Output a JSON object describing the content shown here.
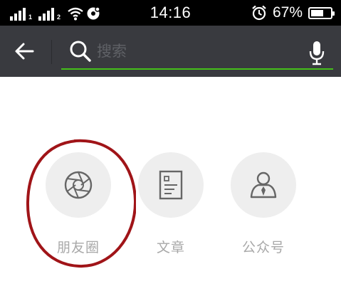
{
  "status_bar": {
    "time": "14:16",
    "battery_percent": "67%",
    "battery_level": 0.67,
    "sim1_label": "1",
    "sim2_label": "2",
    "icons": [
      "signal-icon",
      "signal-icon",
      "wifi-icon",
      "notification-icon",
      "alarm-icon",
      "battery-icon"
    ]
  },
  "search": {
    "placeholder": "搜索",
    "value": "",
    "underline_color": "#45c01a",
    "icons": [
      "back-arrow-icon",
      "search-icon",
      "microphone-icon"
    ]
  },
  "categories": [
    {
      "label": "朋友圈",
      "icon": "aperture-icon"
    },
    {
      "label": "文章",
      "icon": "article-icon"
    },
    {
      "label": "公众号",
      "icon": "official-account-icon"
    }
  ],
  "colors": {
    "status_bar_bg": "#000000",
    "search_bar_bg": "#393a3f",
    "accent_green": "#45c01a",
    "annotation_red": "#a01418",
    "category_circle": "#eeeeee",
    "category_label": "#a8a8a8"
  }
}
